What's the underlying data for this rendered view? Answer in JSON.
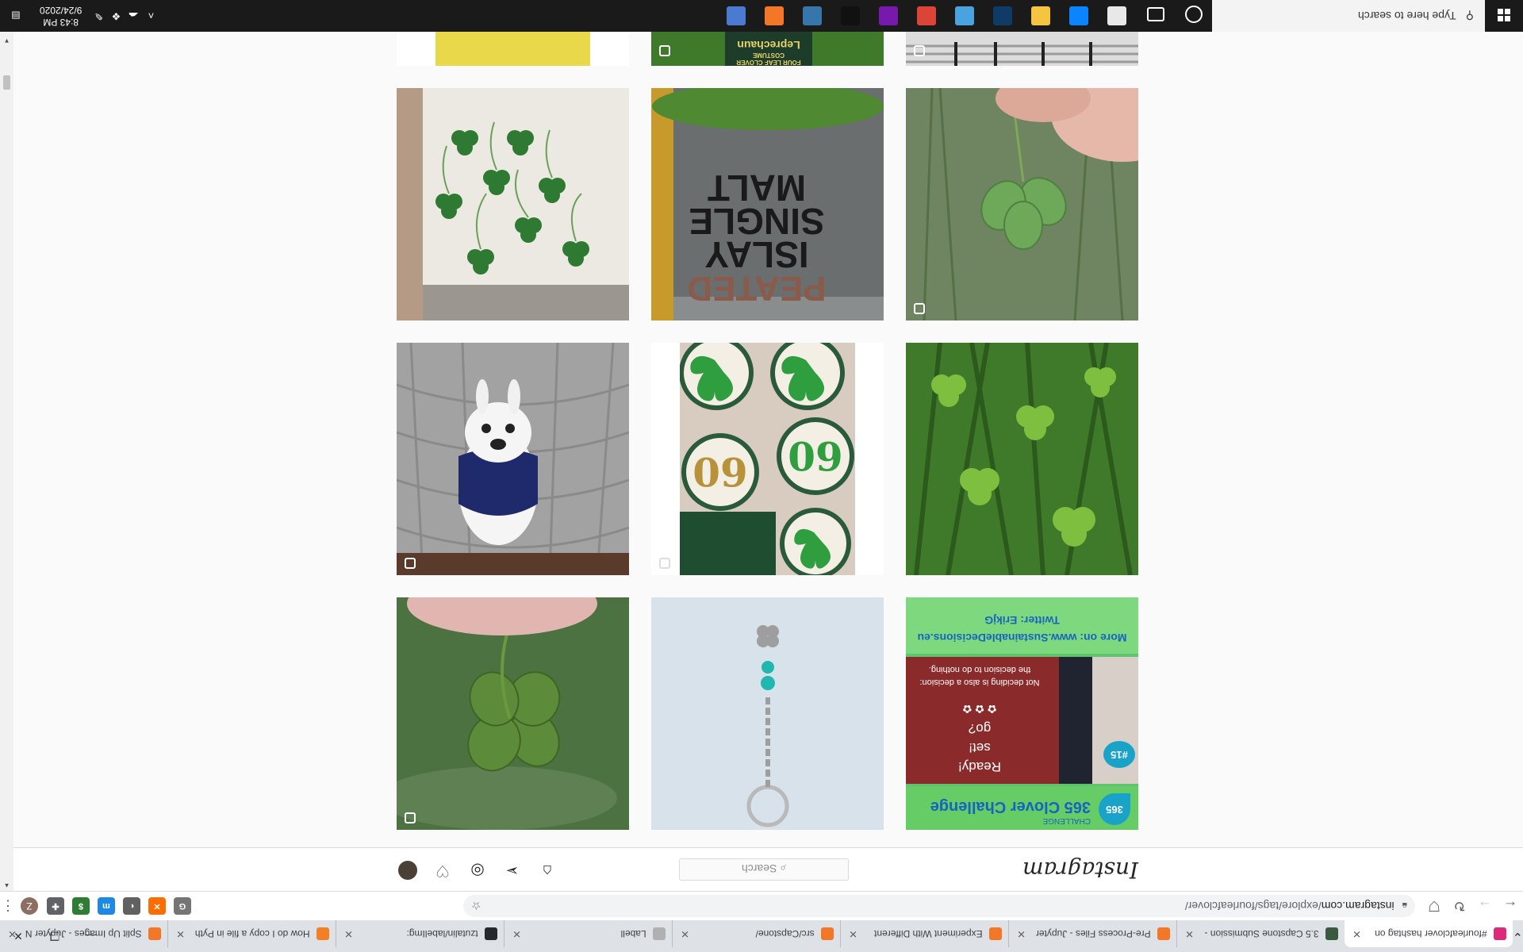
{
  "browser": {
    "tabs": [
      {
        "title": "#fourleafclover hashtag on",
        "fav": "#dd2a7b",
        "active": true
      },
      {
        "title": "3.5 Capstone Submission - ",
        "fav": "#3a5a40"
      },
      {
        "title": "Pre-Process Files - Jupyter",
        "fav": "#f37726"
      },
      {
        "title": "Experiment With Different",
        "fav": "#f37726"
      },
      {
        "title": "src/Capstone/",
        "fav": "#f37726"
      },
      {
        "title": "Labell",
        "fav": "#b0b0b0"
      },
      {
        "title": "tzutalin/labelImg: ",
        "fav": "#24292e"
      },
      {
        "title": "How do I copy a file in Pyth",
        "fav": "#f48024"
      },
      {
        "title": "Split Up Images - Jupyter N",
        "fav": "#f37726"
      }
    ],
    "url_host": "instagram.com",
    "url_path": "/explore/tags/fourleafclover/",
    "back": "←",
    "forward": "→",
    "reload": "↻",
    "new_tab": "+",
    "close_x": "✕",
    "profile_initial": "Z",
    "extensions": [
      {
        "label": "G",
        "color": "#757575"
      },
      {
        "label": "✕",
        "color": "#ff6d00"
      },
      {
        "label": "◐",
        "color": "#616161"
      },
      {
        "label": "m",
        "color": "#1e88e5"
      },
      {
        "label": "$",
        "color": "#2e7d32"
      },
      {
        "label": "✚",
        "color": "#5f6368"
      }
    ]
  },
  "instagram": {
    "logo": "Instagram",
    "search_placeholder": "Search",
    "nav_icons": [
      "home-icon",
      "direct-icon",
      "explore-icon",
      "activity-icon",
      "profile-icon"
    ]
  },
  "posts": [
    {
      "desc": "flowers",
      "multi": false
    },
    {
      "desc": "leprechaun-book",
      "multi": true
    },
    {
      "desc": "garden-hooks",
      "multi": true
    },
    {
      "desc": "clovers-on-table",
      "multi": false
    },
    {
      "desc": "peated-islay-single-malt-bottle",
      "multi": false
    },
    {
      "desc": "clover-leaf-in-fingers",
      "multi": true
    },
    {
      "desc": "dog-on-pavers",
      "multi": true
    },
    {
      "desc": "clover-cookies",
      "multi": true
    },
    {
      "desc": "clover-in-grass",
      "multi": false
    },
    {
      "desc": "four-leaf-clover-held",
      "multi": true
    },
    {
      "desc": "clover-keychain",
      "multi": false
    },
    {
      "desc": "365-clover-challenge",
      "multi": false
    }
  ],
  "whisky": {
    "line1": "PEATED",
    "line2": "ISLAY",
    "line3": "SINGLE",
    "line4": "MALT"
  },
  "cookies": {
    "number": "60"
  },
  "book": {
    "title": "Leprechaun",
    "subtitle": "FOUR LEAF CLOVER COSTUME"
  },
  "challenge": {
    "badge": "365",
    "title": "365 Clover Challenge",
    "small": "CHALLENGE",
    "day": "#15",
    "ready1": "Ready!",
    "ready2": "set!",
    "ready3": "go?",
    "clovers": "✿ ✿ ✿",
    "quote1": "Not deciding is also a decision:",
    "quote2": "the decision to do nothing.",
    "more": "More on: www.SustainableDecisions.eu",
    "twitter": "Twitter: ErikjG"
  },
  "taskbar": {
    "search_placeholder": "Type here to search",
    "time": "8:43 PM",
    "date": "9/24/2020",
    "apps": [
      {
        "name": "cortana-icon",
        "color": "#1a1a1a"
      },
      {
        "name": "task-view-icon",
        "color": "#1a1a1a"
      },
      {
        "name": "calculator-icon",
        "color": "#e8e8e8"
      },
      {
        "name": "edge-icon",
        "color": "#0a84ff"
      },
      {
        "name": "file-explorer-icon",
        "color": "#f5c542"
      },
      {
        "name": "photoshop-icon",
        "color": "#0f3b66"
      },
      {
        "name": "photos-icon",
        "color": "#4aa3df"
      },
      {
        "name": "chrome-icon",
        "color": "#db4437"
      },
      {
        "name": "onenote-icon",
        "color": "#7719aa"
      },
      {
        "name": "terminal-icon",
        "color": "#111111"
      },
      {
        "name": "python-icon",
        "color": "#3776ab"
      },
      {
        "name": "jupyter-icon",
        "color": "#f37726"
      },
      {
        "name": "store-icon",
        "color": "#4a7bd1"
      }
    ]
  }
}
